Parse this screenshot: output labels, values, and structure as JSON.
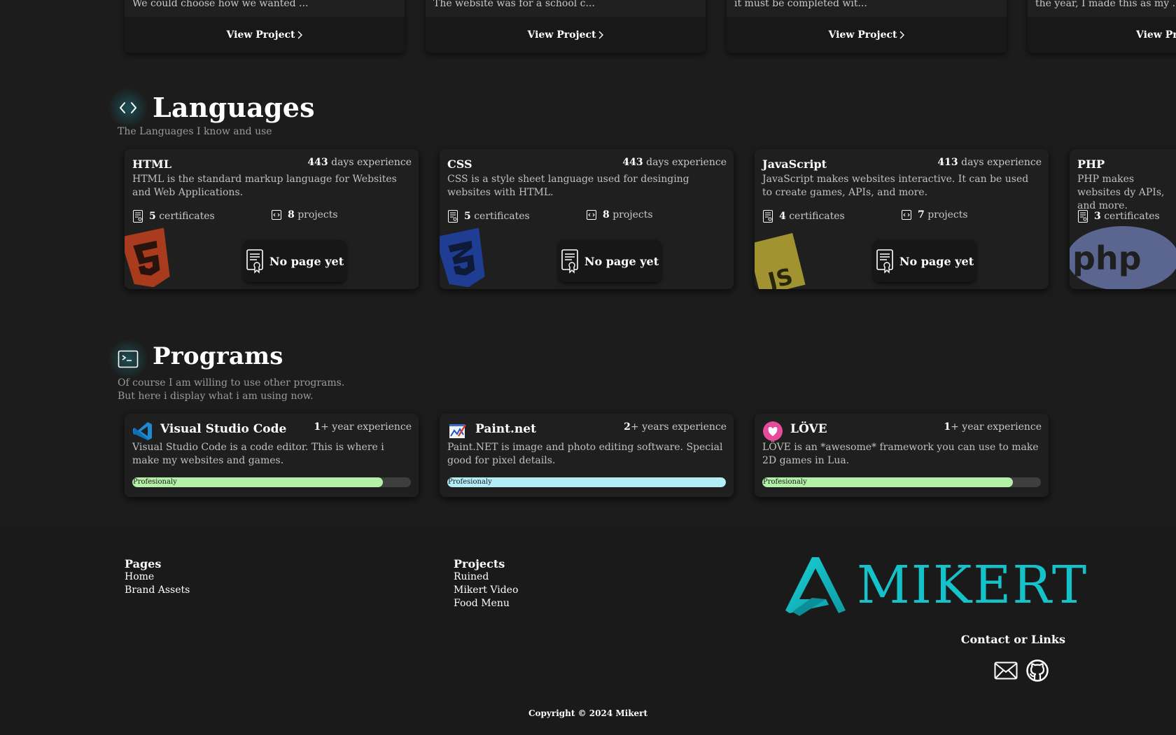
{
  "projects": [
    {
      "desc": "We could choose how we wanted ...",
      "view_label": "View Project"
    },
    {
      "desc": "The website was for a school c...",
      "view_label": "View Project"
    },
    {
      "desc": "it must be completed wit...",
      "view_label": "View Project"
    },
    {
      "desc": "the year, I made this as my ...",
      "view_label": "View Proj"
    }
  ],
  "languages": {
    "icon": "code-brackets-icon",
    "title": "Languages",
    "subtitle": "The Languages I know and use",
    "cards": [
      {
        "name": "HTML",
        "days": "443",
        "days_label": "days experience",
        "desc": "HTML is the standard markup language for Websites and Web Applications.",
        "certs": "5",
        "certs_label": "certificates",
        "projects": "8",
        "projects_label": "projects",
        "button": "No page yet",
        "logo": "html5-logo",
        "logo_color": "#c2411e"
      },
      {
        "name": "CSS",
        "days": "443",
        "days_label": "days experience",
        "desc": "CSS is a style sheet language used for desinging websites with HTML.",
        "certs": "5",
        "certs_label": "certificates",
        "projects": "8",
        "projects_label": "projects",
        "button": "No page yet",
        "logo": "css3-logo",
        "logo_color": "#1f44a8"
      },
      {
        "name": "JavaScript",
        "days": "413",
        "days_label": "days experience",
        "desc": "JavaScript makes websites interactive. It can be used to create games, APIs, and more.",
        "certs": "4",
        "certs_label": "certificates",
        "projects": "7",
        "projects_label": "projects",
        "button": "No page yet",
        "logo": "js-logo",
        "logo_color": "#b9a835"
      },
      {
        "name": "PHP",
        "days": "",
        "days_label": "",
        "desc": "PHP makes websites dy APIs, and more.",
        "certs": "3",
        "certs_label": "certificates",
        "projects": "",
        "projects_label": "",
        "button": "",
        "logo": "php-logo",
        "logo_color": "#5a6590"
      }
    ]
  },
  "programs": {
    "icon": "terminal-icon",
    "title": "Programs",
    "subtitle_line1": "Of course I am willing to use other programs.",
    "subtitle_line2": "But here i display what i am using now.",
    "cards": [
      {
        "name": "Visual Studio Code",
        "exp_num": "1",
        "exp_label": "+ year experience",
        "desc": "Visual Studio Code is a code editor. This is where i make my websites and games.",
        "level": 0.9,
        "level_label": "Profesionaly",
        "bar_color": "#b4f0a8",
        "icon": "vscode-icon"
      },
      {
        "name": "Paint.net",
        "exp_num": "2",
        "exp_label": "+ years experience",
        "desc": "Paint.NET is image and photo editing software. Special good for pixel details.",
        "level": 1.0,
        "level_label": "Profesionaly",
        "bar_color": "#b3eef6",
        "icon": "paintnet-icon"
      },
      {
        "name": "LÖVE",
        "exp_num": "1",
        "exp_label": "+ year experience",
        "desc": "LÖVE is an *awesome* framework you can use to make 2D games in Lua.",
        "level": 0.9,
        "level_label": "Profesionaly",
        "bar_color": "#b4f0a8",
        "icon": "love-heart-icon"
      }
    ]
  },
  "footer": {
    "pages_heading": "Pages",
    "pages": [
      "Home",
      "Brand Assets"
    ],
    "projects_heading": "Projects",
    "projects": [
      "Ruined",
      "Mikert Video",
      "Food Menu"
    ],
    "brand": "MIKERT",
    "brand_color": "#15c2c9",
    "contact_heading": "Contact or Links",
    "copyright": "Copyright © 2024 Mikert"
  }
}
